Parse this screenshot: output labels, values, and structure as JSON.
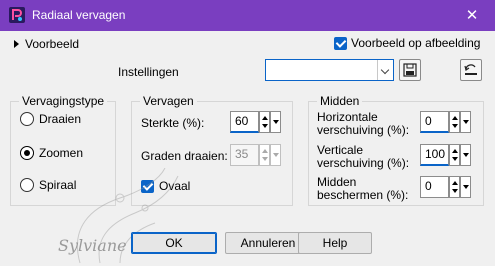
{
  "window": {
    "title": "Radiaal vervagen",
    "close_glyph": "✕"
  },
  "preview": {
    "toggle_label": "Voorbeeld",
    "on_image_label": "Voorbeeld op afbeelding",
    "on_image_checked": true
  },
  "settings": {
    "label": "Instellingen",
    "value": "",
    "save_icon": "floppy-disk-icon",
    "reset_icon": "reset-arrow-icon"
  },
  "blur_type": {
    "title": "Vervagingstype",
    "options": [
      {
        "label": "Draaien",
        "selected": false
      },
      {
        "label": "Zoomen",
        "selected": true
      },
      {
        "label": "Spiraal",
        "selected": false
      }
    ]
  },
  "blur": {
    "title": "Vervagen",
    "strength_label": "Sterkte (%):",
    "strength_value": "60",
    "rotate_label": "Graden draaien:",
    "rotate_value": "35",
    "oval_label": "Ovaal",
    "oval_checked": true
  },
  "center": {
    "title": "Midden",
    "h_offset_label_1": "Horizontale",
    "h_offset_label_2": "verschuiving (%):",
    "h_offset_value": "0",
    "v_offset_label_1": "Verticale",
    "v_offset_label_2": "verschuiving (%):",
    "v_offset_value": "100",
    "protect_label_1": "Midden",
    "protect_label_2": "beschermen (%):",
    "protect_value": "0"
  },
  "buttons": {
    "ok": "OK",
    "cancel": "Annuleren",
    "help": "Help"
  },
  "watermark": {
    "text": "Sylviane"
  },
  "colors": {
    "titlebar": "#7a3ec0",
    "accent": "#0a64c8"
  }
}
